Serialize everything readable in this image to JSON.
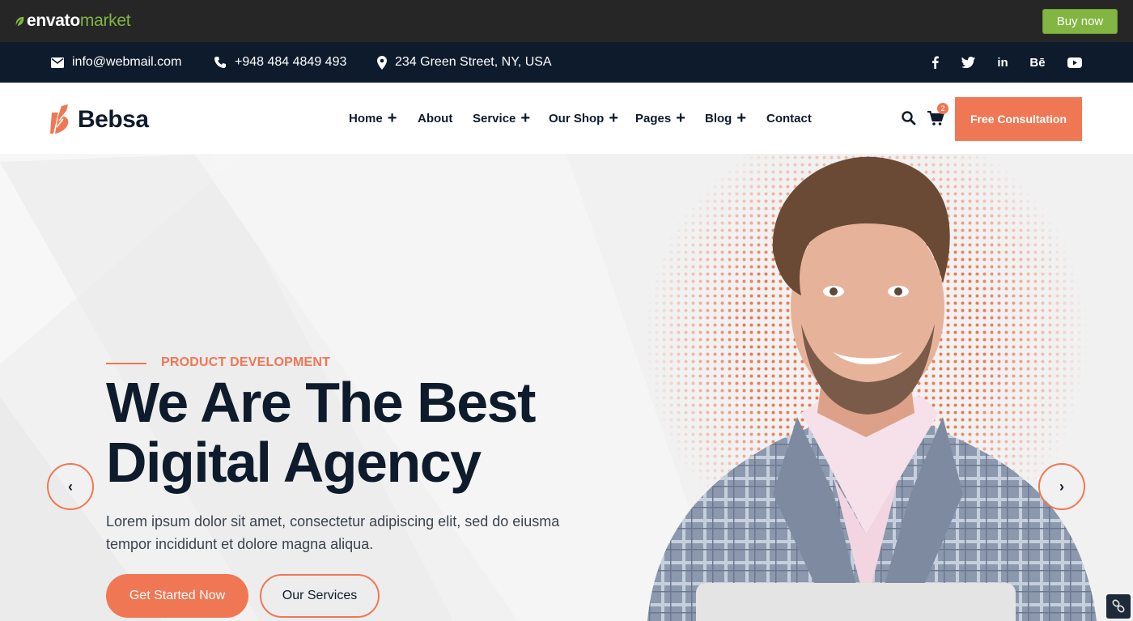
{
  "envato": {
    "logo_main": "envato",
    "logo_sub": "market",
    "buy_label": "Buy now",
    "brand_color": "#82b541"
  },
  "contact": {
    "email": "info@webmail.com",
    "phone": "+948 484 4849 493",
    "address": "234 Green Street, NY, USA"
  },
  "social": {
    "items": [
      "facebook-icon",
      "twitter-icon",
      "linkedin-icon",
      "behance-icon",
      "youtube-icon"
    ],
    "linkedin_label": "in",
    "behance_label": "Bē"
  },
  "site": {
    "brand": "Bebsa",
    "nav": [
      {
        "label": "Home",
        "has_submenu": true
      },
      {
        "label": "About",
        "has_submenu": false
      },
      {
        "label": "Service",
        "has_submenu": true
      },
      {
        "label": "Our Shop",
        "has_submenu": true
      },
      {
        "label": "Pages",
        "has_submenu": true
      },
      {
        "label": "Blog",
        "has_submenu": true
      },
      {
        "label": "Contact",
        "has_submenu": false
      }
    ],
    "cart_count": "2",
    "cta_label": "Free Consultation",
    "accent_color": "#f07754",
    "dark_color": "#0e1b2c"
  },
  "hero": {
    "kicker": "PRODUCT DEVELOPMENT",
    "title_line1": "We Are The Best",
    "title_line2": "Digital Agency",
    "description": "Lorem ipsum dolor sit amet, consectetur adipiscing elit, sed do eiusma tempor incididunt et dolore magna aliqua.",
    "primary_button": "Get Started Now",
    "secondary_button": "Our Services",
    "prev_arrow": "‹",
    "next_arrow": "›"
  }
}
